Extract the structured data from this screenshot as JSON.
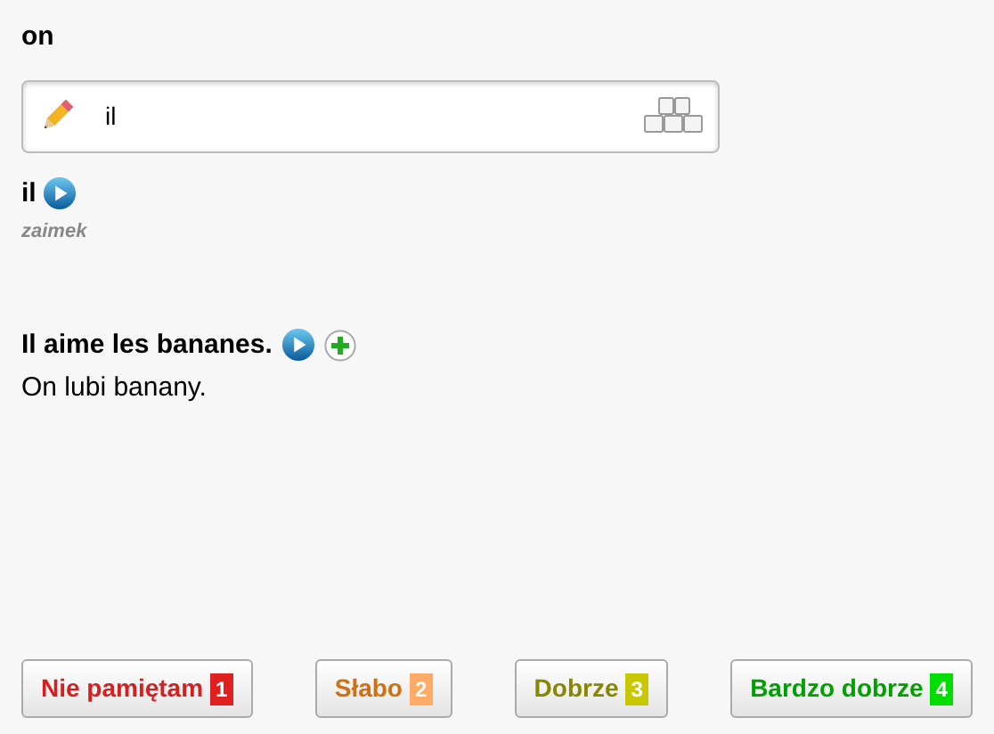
{
  "question": "on",
  "answer_field": {
    "value": "il"
  },
  "word": {
    "text": "il",
    "part_of_speech": "zaimek"
  },
  "example": {
    "sentence": "Il aime les bananes.",
    "translation": "On lubi banany."
  },
  "grades": [
    {
      "label": "Nie pamiętam",
      "key": "1",
      "color": "#e02020",
      "kind": "forgot"
    },
    {
      "label": "Słabo",
      "key": "2",
      "color": "#ffaa66",
      "kind": "weak"
    },
    {
      "label": "Dobrze",
      "key": "3",
      "color": "#c8c800",
      "kind": "good"
    },
    {
      "label": "Bardzo dobrze",
      "key": "4",
      "color": "#00dd00",
      "kind": "great"
    }
  ]
}
